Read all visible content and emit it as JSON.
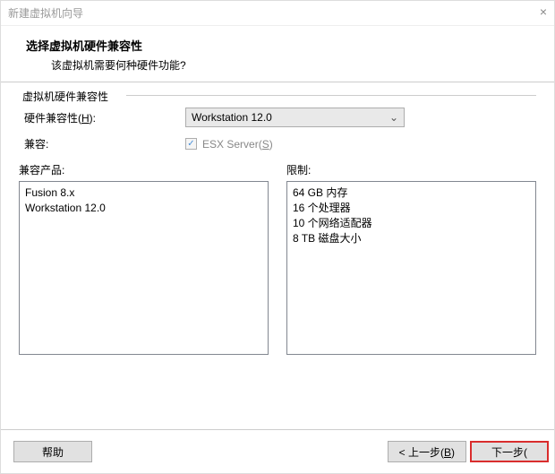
{
  "titlebar": {
    "title": "新建虚拟机向导",
    "close": "×"
  },
  "header": {
    "h1": "选择虚拟机硬件兼容性",
    "h2": "该虚拟机需要何种硬件功能?"
  },
  "section": {
    "title": "虚拟机硬件兼容性",
    "hw_label_pre": "硬件兼容性(",
    "hw_label_key": "H",
    "hw_label_post": "):",
    "hw_value": "Workstation 12.0",
    "compat_label": "兼容:",
    "esx_pre": "ESX Server(",
    "esx_key": "S",
    "esx_post": ")"
  },
  "compat": {
    "label": "兼容产品:",
    "items": [
      "Fusion 8.x",
      "Workstation 12.0"
    ]
  },
  "limits": {
    "label": "限制:",
    "items": [
      "64 GB 内存",
      "16 个处理器",
      "10 个网络适配器",
      "8 TB 磁盘大小"
    ]
  },
  "footer": {
    "help": "帮助",
    "back_pre": "< 上一步(",
    "back_key": "B",
    "back_post": ")",
    "next_pre": "下一步(",
    "next_partial": ""
  }
}
